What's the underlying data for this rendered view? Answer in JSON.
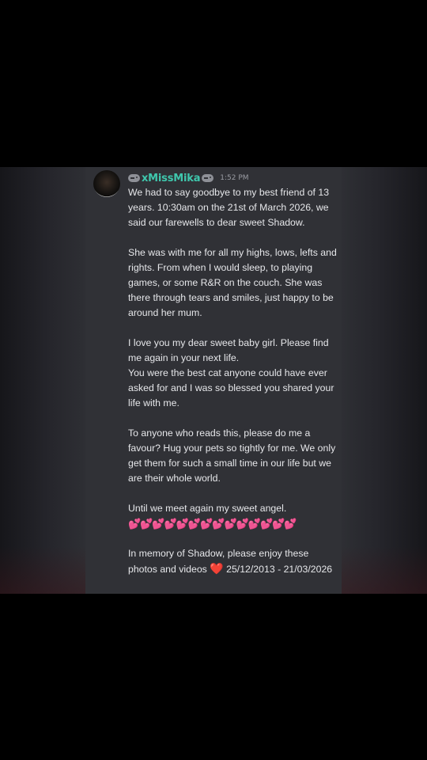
{
  "message": {
    "username": "xMissMika",
    "timestamp": "1:52 PM",
    "paragraphs": {
      "p1": "We had to say goodbye to my best friend of 13 years. 10:30am on the 21st of March 2026, we said our farewells to dear sweet Shadow.",
      "p2": "She was with me for all my highs, lows, lefts and rights. From when I would sleep, to playing games, or some R&R on the couch. She was there through tears and smiles, just happy to be around her mum.",
      "p3a": "I love you my dear sweet baby girl. Please find me again in your next life.",
      "p3b": "You were the best cat anyone could have ever asked for and I was so blessed you shared your life with me.",
      "p4": "To anyone who reads this, please do me a favour? Hug your pets so tightly for me. We only get them for such a small time in our life but we are their whole world.",
      "p5": "Until we meet again my sweet angel.",
      "hearts": "💕💕💕💕💕💕💕💕💕💕💕💕💕💕",
      "p6a": "In memory of Shadow, please enjoy these photos and videos",
      "heart": "❤️",
      "p6b": "25/12/2013 - 21/03/2026"
    }
  },
  "icons": {
    "avatar": "avatar",
    "name_prefix": "gamepad-icon",
    "name_suffix": "gamepad-icon"
  },
  "colors": {
    "username": "#3fc7ad",
    "message_background": "#303136",
    "text": "#e6e7ea",
    "heart": "#e0304a"
  }
}
